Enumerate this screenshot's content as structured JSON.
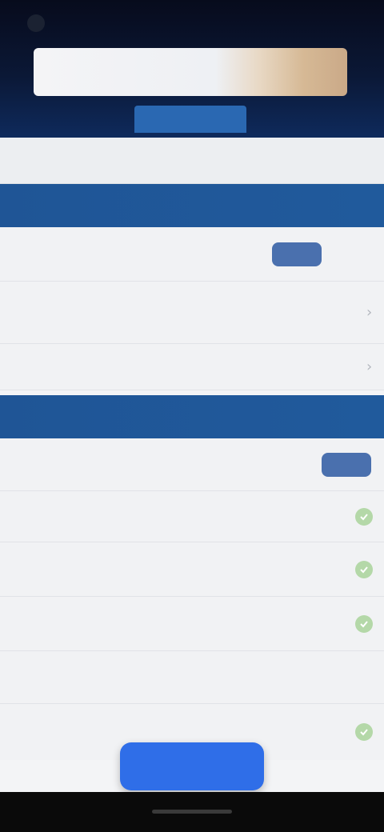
{
  "header": {
    "banner_text": "",
    "tab_label": ""
  },
  "breadcrumb": "",
  "sections": [
    {
      "title": "",
      "rows": [
        {
          "title": "",
          "sub": "",
          "button": ""
        },
        {
          "title": "",
          "sub": ""
        },
        {
          "title": "",
          "sub": ""
        }
      ]
    },
    {
      "title": "",
      "rows": [
        {
          "title": "",
          "value": "",
          "button": ""
        },
        {
          "title": "",
          "checked": true
        },
        {
          "title": "",
          "sub": "",
          "checked": true
        },
        {
          "title": "",
          "sub": "",
          "checked": true
        },
        {
          "title": "",
          "sub": ""
        },
        {
          "title": "",
          "checked": true
        }
      ]
    }
  ],
  "action_button": "",
  "colors": {
    "accent": "#2f6ee8",
    "section_header": "#1f5596",
    "check": "#b4d8a8"
  }
}
